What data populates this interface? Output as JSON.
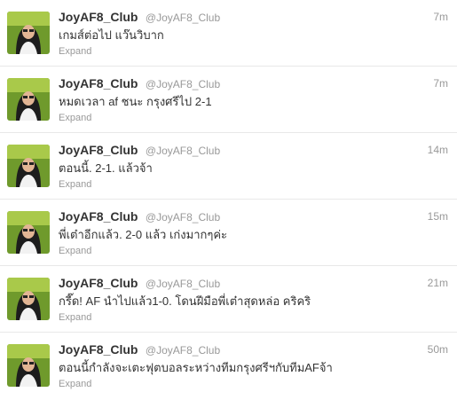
{
  "tweets": [
    {
      "name": "JoyAF8_Club",
      "handle": "@JoyAF8_Club",
      "time": "7m",
      "text": "เกมส์ต่อไป แว๊นวิบาก",
      "expand": "Expand"
    },
    {
      "name": "JoyAF8_Club",
      "handle": "@JoyAF8_Club",
      "time": "7m",
      "text": "หมดเวลา af ชนะ กรุงศรีไป 2-1",
      "expand": "Expand"
    },
    {
      "name": "JoyAF8_Club",
      "handle": "@JoyAF8_Club",
      "time": "14m",
      "text": "ตอนนี้. 2-1. แล้วจ้า",
      "expand": "Expand"
    },
    {
      "name": "JoyAF8_Club",
      "handle": "@JoyAF8_Club",
      "time": "15m",
      "text": "พี่เต๋าอีกแล้ว. 2-0 แล้ว เก่งมากๆค่ะ",
      "expand": "Expand"
    },
    {
      "name": "JoyAF8_Club",
      "handle": "@JoyAF8_Club",
      "time": "21m",
      "text": "กรี๊ด! AF นำไปแล้ว1-0. โดนฝีมือพี่เต๋าสุดหล่อ คริคริ",
      "expand": "Expand"
    },
    {
      "name": "JoyAF8_Club",
      "handle": "@JoyAF8_Club",
      "time": "50m",
      "text": "ตอนนี้กำลังจะเตะฟุตบอลระหว่างทีมกรุงศรีฯกับทีมAFจ้า",
      "expand": "Expand"
    }
  ]
}
